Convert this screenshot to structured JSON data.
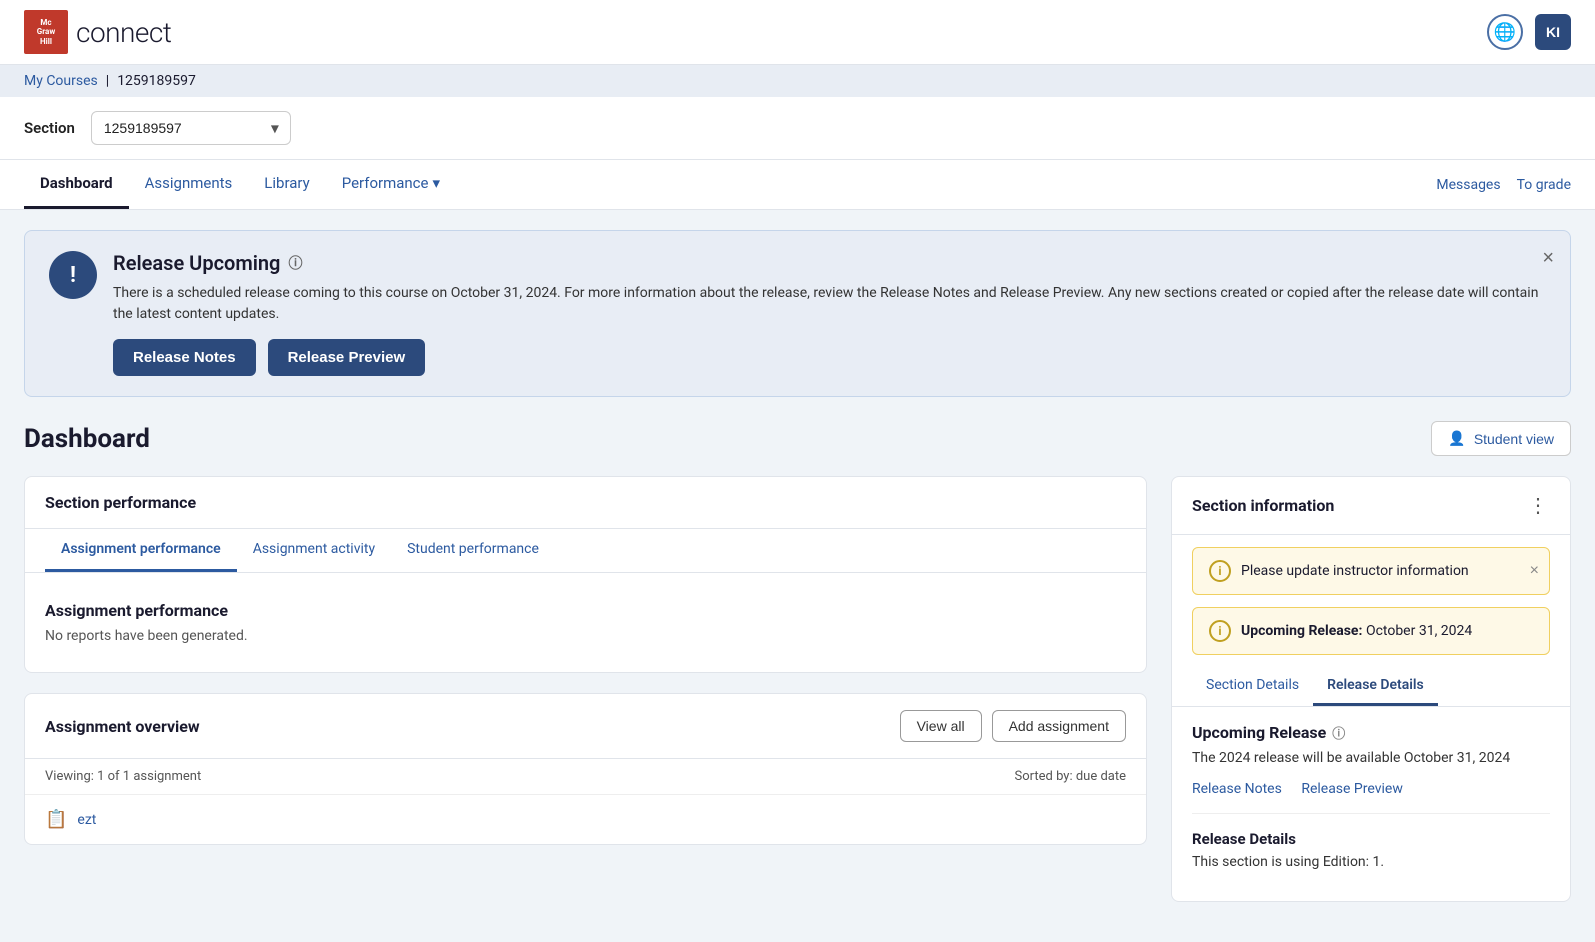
{
  "header": {
    "logo_line1": "Mc",
    "logo_line2": "Graw",
    "logo_line3": "Hill",
    "app_name": "connect",
    "avatar_initials": "KI"
  },
  "breadcrumb": {
    "my_courses_label": "My Courses",
    "separator": "|",
    "section_id": "1259189597"
  },
  "section_bar": {
    "label": "Section",
    "selected_value": "1259189597"
  },
  "nav": {
    "tabs": [
      {
        "label": "Dashboard",
        "active": true
      },
      {
        "label": "Assignments",
        "active": false
      },
      {
        "label": "Library",
        "active": false
      },
      {
        "label": "Performance",
        "active": false,
        "has_dropdown": true
      }
    ],
    "right_links": [
      {
        "label": "Messages"
      },
      {
        "label": "To grade"
      }
    ]
  },
  "alert_banner": {
    "title": "Release Upcoming",
    "body": "There is a scheduled release coming to this course on October 31, 2024. For more information about the release, review the Release Notes and Release Preview. Any new sections created or copied after the release date will contain the latest content updates.",
    "btn_release_notes": "Release Notes",
    "btn_release_preview": "Release Preview"
  },
  "dashboard": {
    "title": "Dashboard",
    "student_view_btn": "Student view"
  },
  "section_performance": {
    "card_title": "Section performance",
    "tabs": [
      {
        "label": "Assignment performance",
        "active": true
      },
      {
        "label": "Assignment activity",
        "active": false
      },
      {
        "label": "Student performance",
        "active": false
      }
    ],
    "content_title": "Assignment performance",
    "content_body": "No reports have been generated."
  },
  "assignment_overview": {
    "card_title": "Assignment overview",
    "view_all_btn": "View all",
    "add_assignment_btn": "Add assignment",
    "viewing_text": "Viewing: 1 of 1 assignment",
    "sorted_by": "Sorted by: due date",
    "item_icon": "📋",
    "item_name": "ezt"
  },
  "section_information": {
    "card_title": "Section information",
    "alert1": "Please update instructor information",
    "alert2_prefix": "Upcoming Release:",
    "alert2_date": "October 31, 2024",
    "tabs": [
      {
        "label": "Section Details",
        "active": false
      },
      {
        "label": "Release Details",
        "active": true
      }
    ],
    "upcoming_release_title": "Upcoming Release",
    "upcoming_release_body": "The 2024 release will be available October 31, 2024",
    "release_notes_link": "Release Notes",
    "release_preview_link": "Release Preview",
    "release_details_title": "Release Details",
    "release_details_body": "This section is using Edition: 1."
  }
}
